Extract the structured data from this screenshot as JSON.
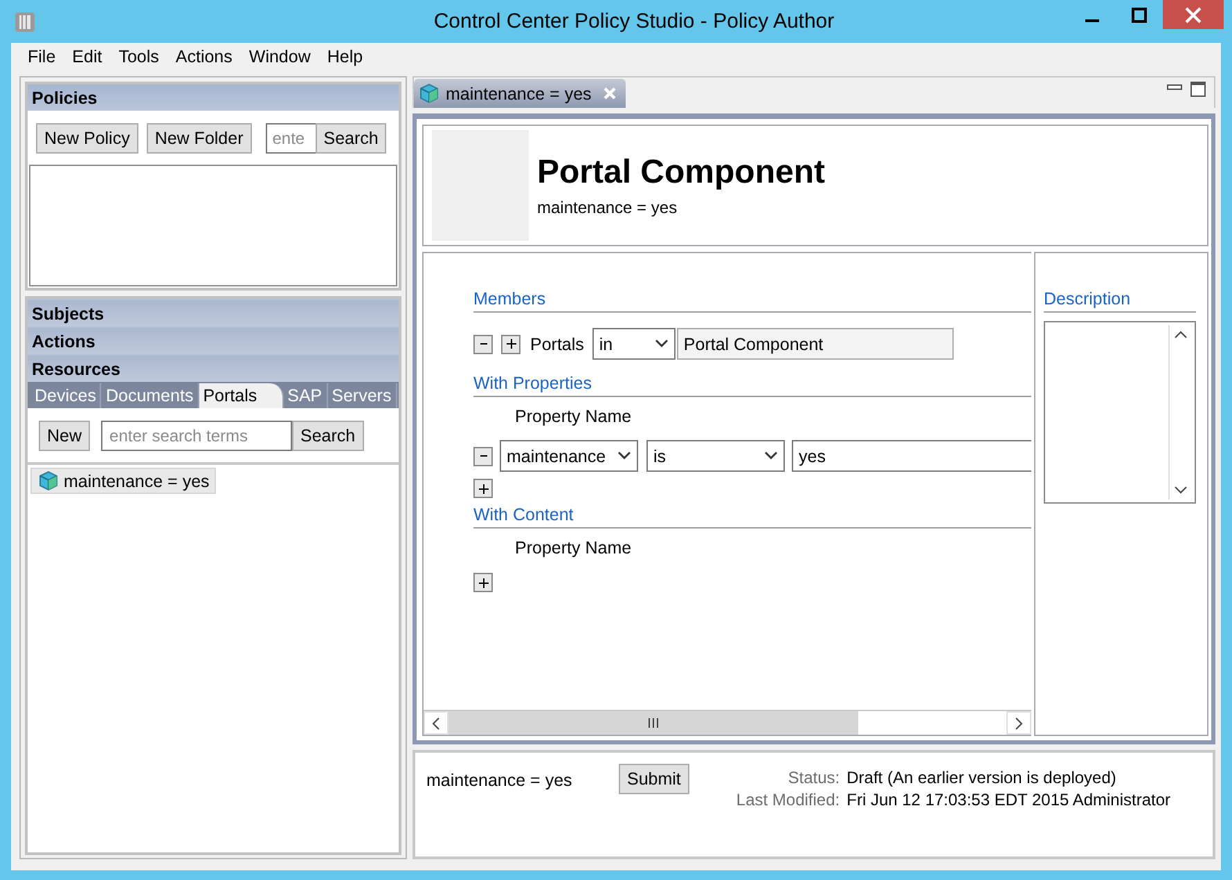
{
  "window": {
    "title": "Control Center Policy Studio - Policy Author"
  },
  "menu": [
    "File",
    "Edit",
    "Tools",
    "Actions",
    "Window",
    "Help"
  ],
  "policies": {
    "title": "Policies",
    "buttons": [
      "New Policy",
      "New Folder"
    ],
    "search": {
      "placeholder": "ente"
    },
    "search_button": "Search"
  },
  "sections": [
    {
      "label": "Subjects"
    },
    {
      "label": "Actions"
    },
    {
      "label": "Resources"
    }
  ],
  "resource_tabs": [
    {
      "label": "Devices",
      "selected": false
    },
    {
      "label": "Documents",
      "selected": false
    },
    {
      "label": "Portals",
      "selected": true
    },
    {
      "label": "SAP",
      "selected": false
    },
    {
      "label": "Servers",
      "selected": false
    }
  ],
  "resource_toolbar": {
    "new_button": "New",
    "search": {
      "placeholder": "enter search terms"
    },
    "search_button": "Search"
  },
  "resource_items": [
    {
      "label": "maintenance = yes",
      "selected": true
    }
  ],
  "editor_tabs": [
    {
      "label": "maintenance = yes",
      "selected": true
    }
  ],
  "header": {
    "title": "Portal Component",
    "subtitle": "maintenance = yes"
  },
  "members": {
    "title": "Members",
    "label": "Portals",
    "operator": "in",
    "value": "Portal Component"
  },
  "with_properties": {
    "title": "With Properties",
    "column": "Property Name",
    "rows": [
      {
        "property": "maintenance",
        "operator": "is",
        "value": "yes"
      }
    ]
  },
  "with_content": {
    "title": "With Content",
    "column": "Property Name"
  },
  "description": {
    "title": "Description"
  },
  "footer": {
    "name": "maintenance = yes",
    "submit": "Submit",
    "status_label": "Status:",
    "status": "Draft (An earlier version is deployed)",
    "modified_label": "Last Modified:",
    "modified": "Fri Jun 12 17:03:53 EDT 2015 Administrator"
  }
}
